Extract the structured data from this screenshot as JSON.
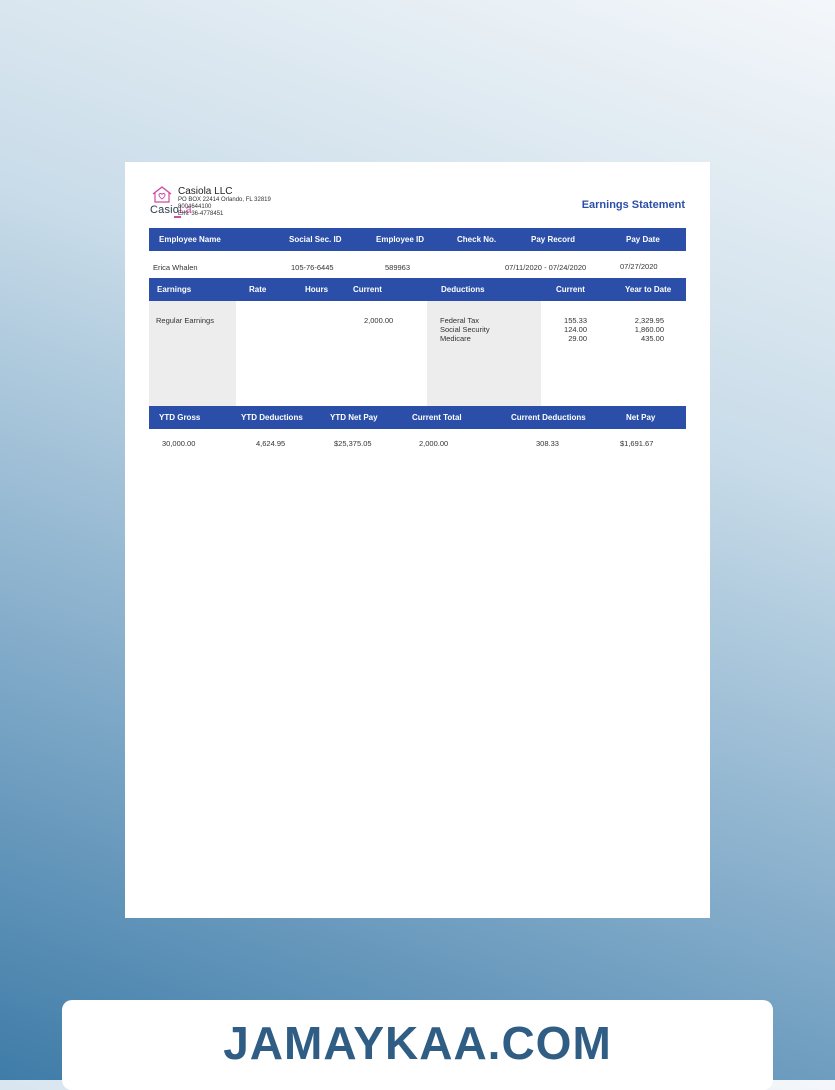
{
  "company": {
    "logo_text_main": "Casio",
    "logo_text_accent": "La",
    "name": "Casiola LLC",
    "address": "PO BOX 22414 Orlando, FL 32819",
    "phone": "8004644100",
    "ein": "EIN: 36-4778451"
  },
  "statement_title": "Earnings Statement",
  "employee_header": {
    "name": "Employee Name",
    "ssn": "Social Sec. ID",
    "id": "Employee ID",
    "check": "Check No.",
    "record": "Pay Record",
    "date": "Pay Date"
  },
  "employee": {
    "name": "Erica Whalen",
    "ssn": "105-76-6445",
    "id": "589963",
    "check": "",
    "record": "07/11/2020 - 07/24/2020",
    "date": "07/27/2020"
  },
  "earnings_header": {
    "earnings": "Earnings",
    "rate": "Rate",
    "hours": "Hours",
    "current": "Current",
    "deductions": "Deductions",
    "ded_current": "Current",
    "ytd": "Year to Date"
  },
  "earnings": [
    {
      "label": "Regular Earnings",
      "rate": "",
      "hours": "",
      "current": "2,000.00"
    }
  ],
  "deductions": [
    {
      "label": "Federal Tax",
      "current": "155.33",
      "ytd": "2,329.95"
    },
    {
      "label": "Social Security",
      "current": "124.00",
      "ytd": "1,860.00"
    },
    {
      "label": "Medicare",
      "current": "29.00",
      "ytd": "435.00"
    }
  ],
  "summary_header": {
    "ytd_gross": "YTD Gross",
    "ytd_deductions": "YTD Deductions",
    "ytd_net": "YTD Net Pay",
    "current_total": "Current Total",
    "current_deductions": "Current Deductions",
    "net_pay": "Net Pay"
  },
  "summary": {
    "ytd_gross": "30,000.00",
    "ytd_deductions": "4,624.95",
    "ytd_net": "$25,375.05",
    "current_total": "2,000.00",
    "current_deductions": "308.33",
    "net_pay": "$1,691.67"
  },
  "watermark": "JAMAYKAA.COM",
  "colors": {
    "header_bar": "#2b4fa8",
    "logo_accent": "#d04aa0",
    "watermark_text": "#2f5d84"
  }
}
